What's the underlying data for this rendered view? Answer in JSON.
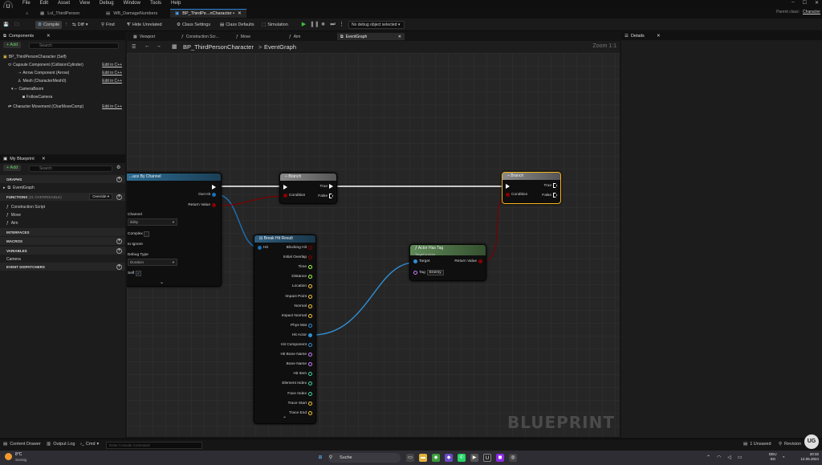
{
  "menubar": {
    "logo": "U",
    "items": [
      "File",
      "Edit",
      "Asset",
      "View",
      "Debug",
      "Window",
      "Tools",
      "Help"
    ],
    "parent_class_label": "Parent class:",
    "parent_class_value": "Character"
  },
  "doc_tabs": [
    {
      "label": "Lvl_ThirdPerson"
    },
    {
      "label": "WB_DamageNumbers"
    },
    {
      "label": "BP_ThirdPe...nCharacter •"
    }
  ],
  "toolbar": {
    "compile": "Compile",
    "diff": "Diff",
    "find": "Find",
    "hide_unrelated": "Hide Unrelated",
    "class_settings": "Class Settings",
    "class_defaults": "Class Defaults",
    "simulation": "Simulation",
    "debug_select": "No debug object selected"
  },
  "components": {
    "title": "Components",
    "add": "+ Add",
    "search_placeholder": "Search",
    "root": "BP_ThirdPersonCharacter (Self)",
    "items": [
      {
        "label": "Capsule Component (CollisionCylinder)",
        "edit": "Edit in C++"
      },
      {
        "label": "Arrow Component (Arrow)",
        "edit": "Edit in C++"
      },
      {
        "label": "Mesh (CharacterMesh0)",
        "edit": "Edit in C++"
      },
      {
        "label": "CameraBoom",
        "edit": ""
      },
      {
        "label": "FollowCamera",
        "edit": ""
      },
      {
        "label": "Character Movement (CharMoveComp)",
        "edit": "Edit in C++"
      }
    ]
  },
  "myblueprint": {
    "title": "My Blueprint",
    "add": "+ Add",
    "search_placeholder": "Search",
    "graphs_header": "GRAPHS",
    "event_graph": "EventGraph",
    "functions_header": "FUNCTIONS",
    "functions_count": "(31 OVERRIDABLE)",
    "override": "Override",
    "functions": [
      "Construction Script",
      "Move",
      "Aim"
    ],
    "interfaces_header": "INTERFACES",
    "macros_header": "MACROS",
    "variables_header": "VARIABLES",
    "variable_category": "Camera",
    "dispatchers_header": "EVENT DISPATCHERS"
  },
  "graph": {
    "tabs": [
      "Viewport",
      "Construction Scr...",
      "Move",
      "Aim",
      "EventGraph"
    ],
    "breadcrumb_bp": "BP_ThirdPersonCharacter",
    "breadcrumb_sep": ">",
    "breadcrumb_graph": "EventGraph",
    "zoom": "Zoom 1:1",
    "watermark": "BLUEPRINT"
  },
  "details": {
    "title": "Details"
  },
  "nodes": {
    "trace": {
      "title": "...ace By Channel",
      "out_hit": "Out Hit",
      "return_value": "Return Value",
      "channel_label": "Channel",
      "channel_value": "ibility",
      "complex": "Complex",
      "ignore": "to Ignore",
      "debug_type": "Debug Type",
      "debug_value": "Duration",
      "self": "Self"
    },
    "branch1": {
      "title": "Branch",
      "condition": "Condition",
      "true": "True",
      "false": "False"
    },
    "branch2": {
      "title": "Branch",
      "condition": "Condition",
      "true": "True",
      "false": "False"
    },
    "breakhit": {
      "title": "Break Hit Result",
      "hit": "Hit",
      "outputs": [
        "Blocking Hit",
        "Initial Overlap",
        "Time",
        "Distance",
        "Location",
        "Impact Point",
        "Normal",
        "Impact Normal",
        "Phys Mat",
        "Hit Actor",
        "Hit Component",
        "Hit Bone Name",
        "Bone Name",
        "Hit Item",
        "Element Index",
        "Face Index",
        "Trace Start",
        "Trace End"
      ]
    },
    "actorhastag": {
      "title": "Actor Has Tag",
      "subtitle": "Target is Actor",
      "target": "Target",
      "tag": "Tag",
      "tag_value": "Enemy",
      "return_value": "Return Value"
    }
  },
  "statusbar": {
    "content_drawer": "Content Drawer",
    "output_log": "Output Log",
    "cmd": "Cmd",
    "cmd_placeholder": "Enter Console Command",
    "unsaved": "1 Unsaved",
    "revision": "Revision"
  },
  "taskbar": {
    "weather_temp": "8°C",
    "weather_text": "Sonnig",
    "search": "Suche",
    "lang": "DEU",
    "lang2": "SG",
    "time": "20:32",
    "date": "12.05.2024"
  },
  "colors": {
    "accent": "#2a7fd4",
    "exec_wire": "#ffffff",
    "bool_pin": "#8c0000",
    "struct_pin": "#0b5c9b",
    "object_pin": "#2f8fd6",
    "float_pin": "#9fff45",
    "vector_pin": "#f8c536",
    "name_pin": "#c87bff",
    "branch_head": "#7a7a7a",
    "function_head": "#3b6f8f",
    "pure_head": "#5f8a58",
    "selected": "#f7b21a"
  }
}
